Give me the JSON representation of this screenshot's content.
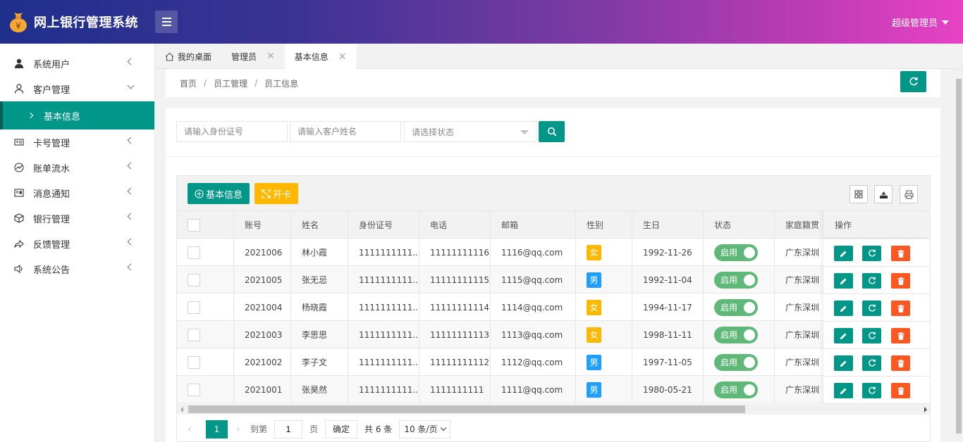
{
  "header": {
    "title": "网上银行管理系统",
    "user": "超级管理员"
  },
  "sidebar": {
    "items": [
      {
        "label": "系统用户",
        "icon": "user-icon"
      },
      {
        "label": "客户管理",
        "icon": "user-outline-icon"
      },
      {
        "label": "卡号管理",
        "icon": "card-icon"
      },
      {
        "label": "账单流水",
        "icon": "chart-icon"
      },
      {
        "label": "消息通知",
        "icon": "message-icon"
      },
      {
        "label": "银行管理",
        "icon": "cube-icon"
      },
      {
        "label": "反馈管理",
        "icon": "share-icon"
      },
      {
        "label": "系统公告",
        "icon": "speaker-icon"
      }
    ],
    "sub_item": "基本信息"
  },
  "tabs": [
    {
      "label": "我的桌面"
    },
    {
      "label": "管理员"
    },
    {
      "label": "基本信息"
    }
  ],
  "breadcrumb": {
    "home": "首页",
    "level1": "员工管理",
    "level2": "员工信息",
    "sep": "/"
  },
  "search": {
    "id_placeholder": "请输入身份证号",
    "name_placeholder": "请输入客户姓名",
    "status_placeholder": "请选择状态"
  },
  "toolbar": {
    "add_label": "基本信息",
    "card_label": "开卡"
  },
  "table": {
    "columns": [
      "账号",
      "姓名",
      "身份证号",
      "电话",
      "邮箱",
      "性别",
      "生日",
      "状态",
      "家庭籍贯",
      "操作"
    ],
    "rows": [
      {
        "account": "2021006",
        "name": "林小霞",
        "idno": "1111111111...",
        "phone": "11111111116",
        "email": "1116@qq.com",
        "sex": "女",
        "sex_color": "#ffb800",
        "birth": "1992-11-26",
        "status": "启用",
        "home": "广东深圳"
      },
      {
        "account": "2021005",
        "name": "张无忌",
        "idno": "1111111111...",
        "phone": "11111111115",
        "email": "1115@qq.com",
        "sex": "男",
        "sex_color": "#1e9fff",
        "birth": "1992-11-04",
        "status": "启用",
        "home": "广东深圳"
      },
      {
        "account": "2021004",
        "name": "杨晓霞",
        "idno": "1111111111...",
        "phone": "11111111114",
        "email": "1114@qq.com",
        "sex": "女",
        "sex_color": "#ffb800",
        "birth": "1994-11-17",
        "status": "启用",
        "home": "广东深圳"
      },
      {
        "account": "2021003",
        "name": "李思思",
        "idno": "1111111111...",
        "phone": "11111111113",
        "email": "1113@qq.com",
        "sex": "女",
        "sex_color": "#ffb800",
        "birth": "1998-11-11",
        "status": "启用",
        "home": "广东深圳"
      },
      {
        "account": "2021002",
        "name": "李子文",
        "idno": "1111111111...",
        "phone": "11111111112",
        "email": "1112@qq.com",
        "sex": "男",
        "sex_color": "#1e9fff",
        "birth": "1997-11-05",
        "status": "启用",
        "home": "广东深圳"
      },
      {
        "account": "2021001",
        "name": "张昊然",
        "idno": "1111111111...",
        "phone": "1111111111",
        "email": "1111@qq.com",
        "sex": "男",
        "sex_color": "#1e9fff",
        "birth": "1980-05-21",
        "status": "启用",
        "home": "广东深圳"
      }
    ]
  },
  "pager": {
    "current": "1",
    "goto_label": "到第",
    "page_input": "1",
    "page_label": "页",
    "ok_label": "确定",
    "total": "共 6 条",
    "size": "10 条/页"
  },
  "colors": {
    "primary": "#009688",
    "warn": "#ffb800",
    "danger": "#ff5722",
    "info": "#1e9fff",
    "switch_on": "#5fb878"
  }
}
